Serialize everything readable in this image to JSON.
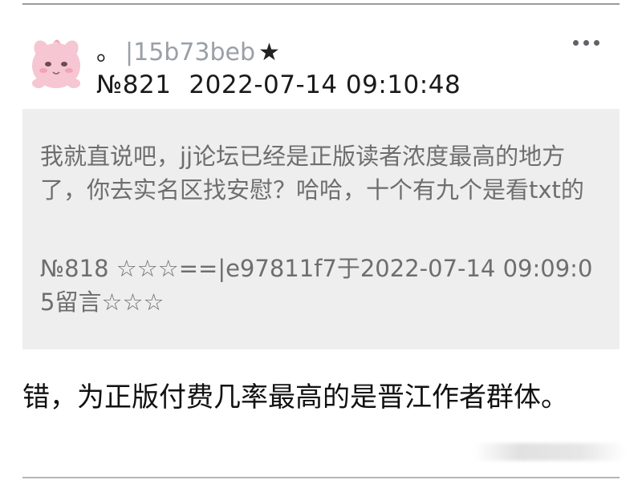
{
  "post": {
    "username_prefix": "。",
    "username_id": "|15b73beb",
    "username_star": "★",
    "post_number": "№821",
    "timestamp": "2022-07-14 09:10:48"
  },
  "quote": {
    "text": "我就直说吧，jj论坛已经是正版读者浓度最高的地方了，你去实名区找安慰？哈哈，十个有九个是看txt的",
    "reference": "№818 ☆☆☆==|e97811f7于2022-07-14 09:09:05留言☆☆☆"
  },
  "reply": {
    "text": "错，为正版付费几率最高的是晋江作者群体。"
  },
  "icons": {
    "more": "more-horizontal-icon",
    "avatar": "avatar-pink-character"
  }
}
